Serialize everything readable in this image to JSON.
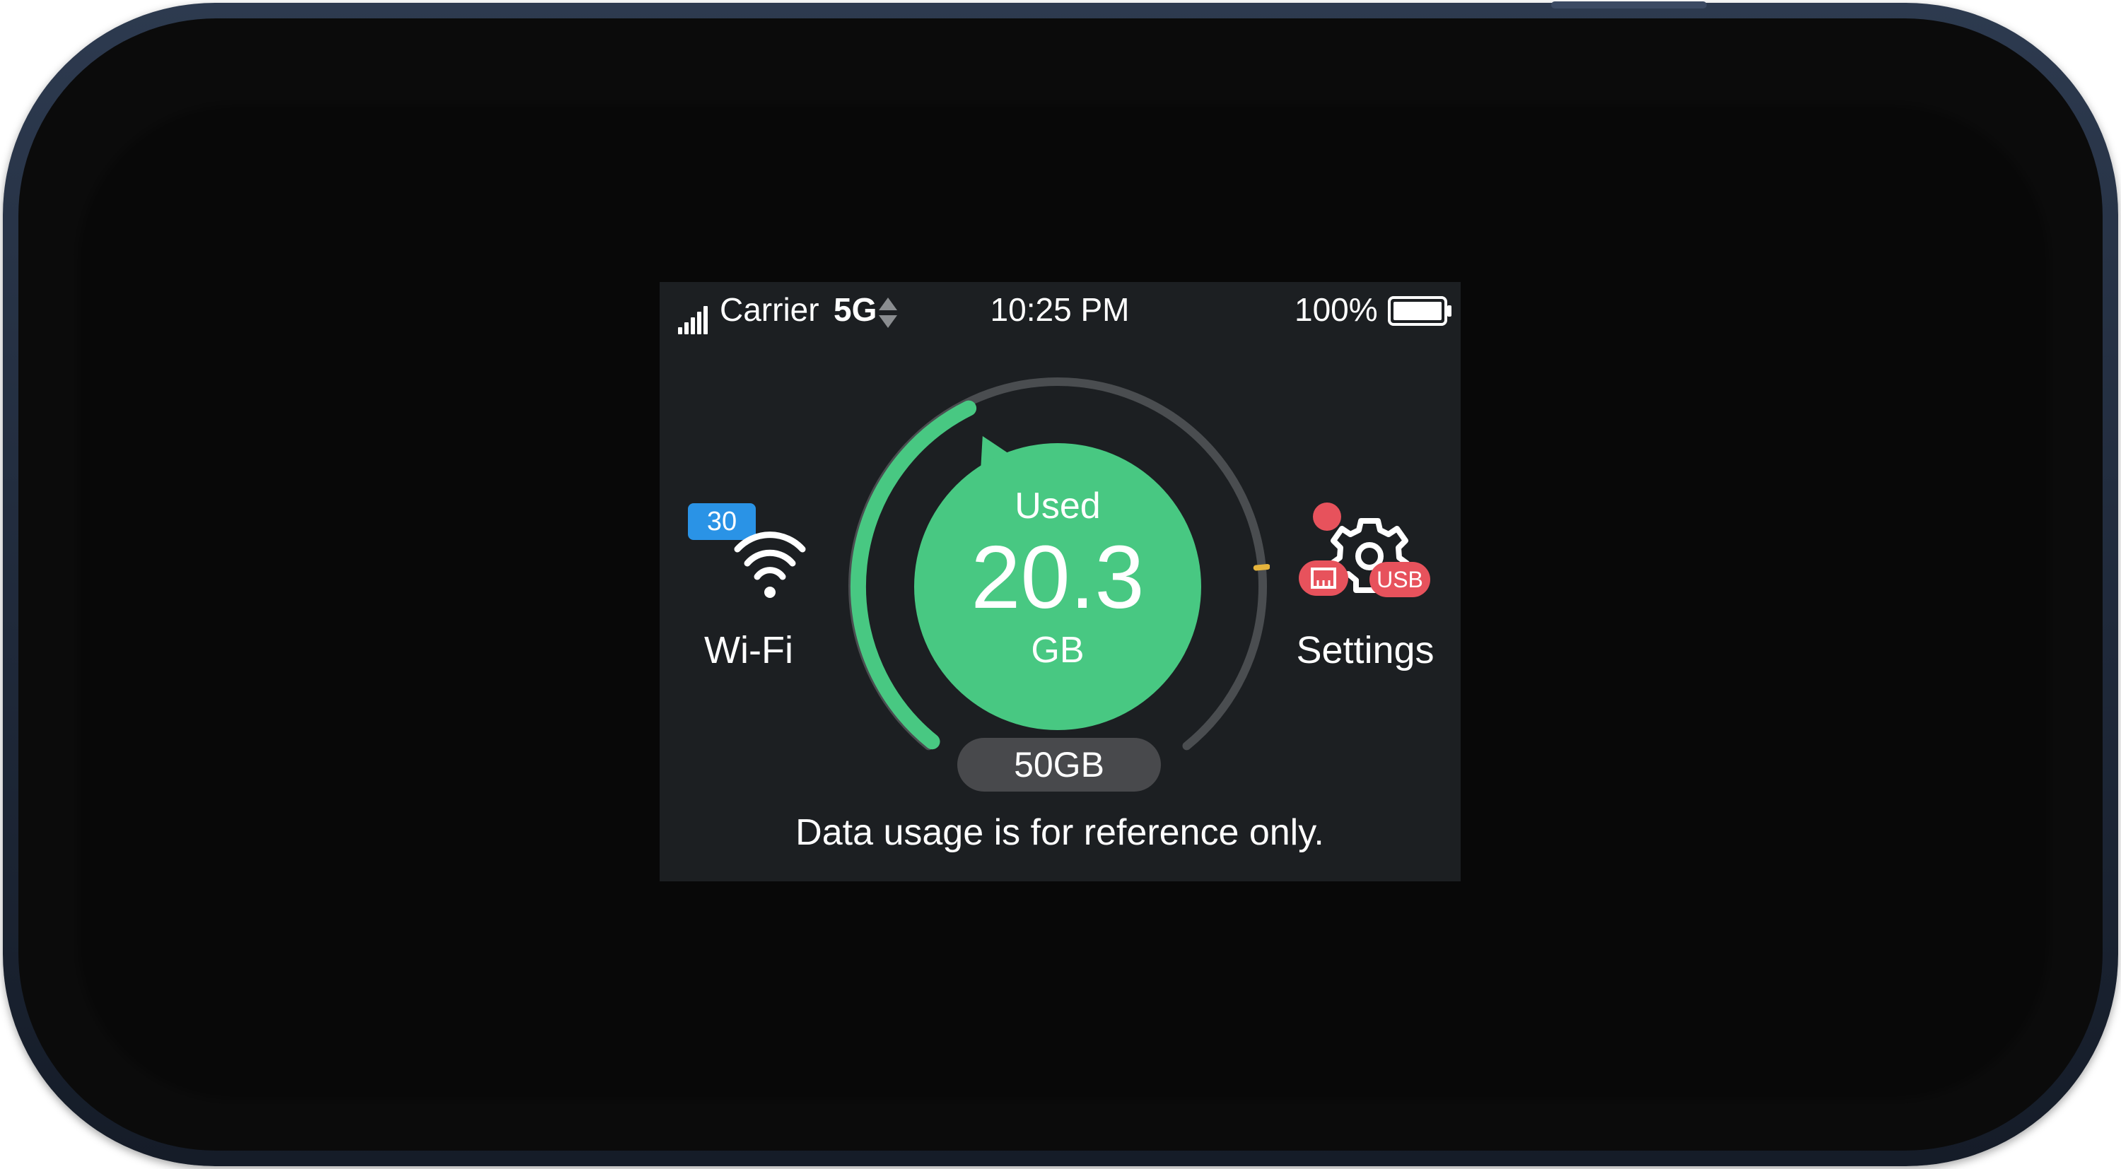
{
  "status_bar": {
    "carrier": "Carrier",
    "network_type": "5G",
    "signal_bars": 5,
    "time": "10:25 PM",
    "battery_percent_label": "100%",
    "battery_level": 1.0
  },
  "wifi": {
    "label": "Wi-Fi",
    "connected_devices_badge": "30",
    "icon": "wifi-icon"
  },
  "usage": {
    "used_label": "Used",
    "used_value": "20.3",
    "unit": "GB",
    "limit_label": "50GB",
    "used_fraction": 0.406,
    "warning_fraction": 0.8,
    "disclaimer": "Data usage is for reference only."
  },
  "settings": {
    "label": "Settings",
    "icon": "gear-icon",
    "usb_badge": "USB",
    "lan_icon": "ethernet-icon"
  },
  "colors": {
    "accent_green": "#48c882",
    "track_gray": "#4a4d50",
    "warning_yellow": "#e6b43c",
    "badge_blue": "#2a93e6",
    "alert_red": "#e7525c",
    "screen_bg": "#1c1f22"
  }
}
